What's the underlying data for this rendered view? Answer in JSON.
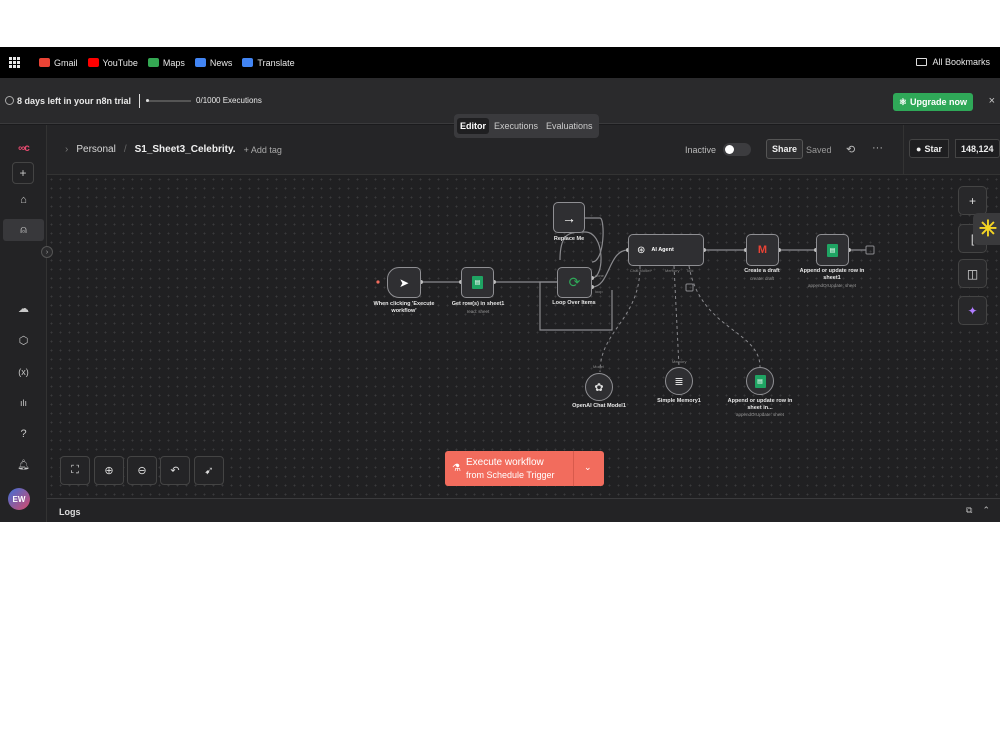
{
  "bookmarks": {
    "items": [
      {
        "label": "Gmail",
        "color": "#ea4335"
      },
      {
        "label": "YouTube",
        "color": "#ff0000"
      },
      {
        "label": "Maps",
        "color": "#34a853"
      },
      {
        "label": "News",
        "color": "#4285f4"
      },
      {
        "label": "Translate",
        "color": "#4285f4"
      }
    ],
    "all_bookmarks": "All Bookmarks"
  },
  "trial": {
    "days_left": "8 days left in your n8n trial",
    "executions": "0/1000 Executions",
    "executions_used_fraction": 0,
    "upgrade_label": "Upgrade now",
    "close": "×"
  },
  "sidebar": {
    "logo": "∞c",
    "add": "+",
    "icons": [
      "home-icon",
      "user-icon",
      "cloud-icon",
      "package-icon",
      "variables-icon",
      "insights-icon",
      "help-icon",
      "bell-icon"
    ],
    "glyphs": {
      "home": "⌂",
      "user": "⍝",
      "cloud": "☁",
      "package": "⬡",
      "variables": "(x)",
      "insights": "ılı",
      "help": "?",
      "bell": "🔔︎"
    },
    "avatar": "EW"
  },
  "header": {
    "breadcrumb_prefix": "›",
    "project": "Personal",
    "separator": "/",
    "workflow_name": "S1_Sheet3_Celebrity.",
    "add_tag": "+ Add tag",
    "status": "Inactive",
    "share": "Share",
    "saved": "Saved",
    "history_glyph": "⟲",
    "more_glyph": "···",
    "github_star": "Star",
    "star_count": "148,124"
  },
  "tabs": [
    {
      "label": "Editor",
      "active": true
    },
    {
      "label": "Executions",
      "active": false
    },
    {
      "label": "Evaluations",
      "active": false
    }
  ],
  "nodes": {
    "trigger": {
      "label": "When clicking 'Execute workflow'"
    },
    "get_rows": {
      "label": "Get row(s) in sheet1",
      "sub": "read: sheet"
    },
    "replace_me": {
      "label": "Replace Me"
    },
    "loop": {
      "label": "Loop Over Items",
      "done": "done",
      "loop": "loop"
    },
    "ai_agent": {
      "label": "AI Agent",
      "ports": [
        "Chat Model*",
        "Memory",
        "Tool"
      ]
    },
    "create_draft": {
      "label": "Create a draft",
      "sub": "create: draft"
    },
    "append_1": {
      "label": "Append or update row in sheet1",
      "sub": "appendOrUpdate: sheet"
    },
    "openai": {
      "label": "OpenAI Chat Model1",
      "port": "Model"
    },
    "memory": {
      "label": "Simple Memory1",
      "port": "Memory"
    },
    "append_2": {
      "label": "Append or update row in sheet in...",
      "sub": "appendOrUpdate: sheet"
    }
  },
  "toolbar": {
    "execute_title": "Execute workflow",
    "execute_sub": "from Schedule Trigger"
  },
  "logs": {
    "title": "Logs"
  },
  "colors": {
    "accent": "#f26c5d",
    "upgrade": "#2fa858",
    "sheets": "#1fa463",
    "brand": "#ea4b71"
  }
}
